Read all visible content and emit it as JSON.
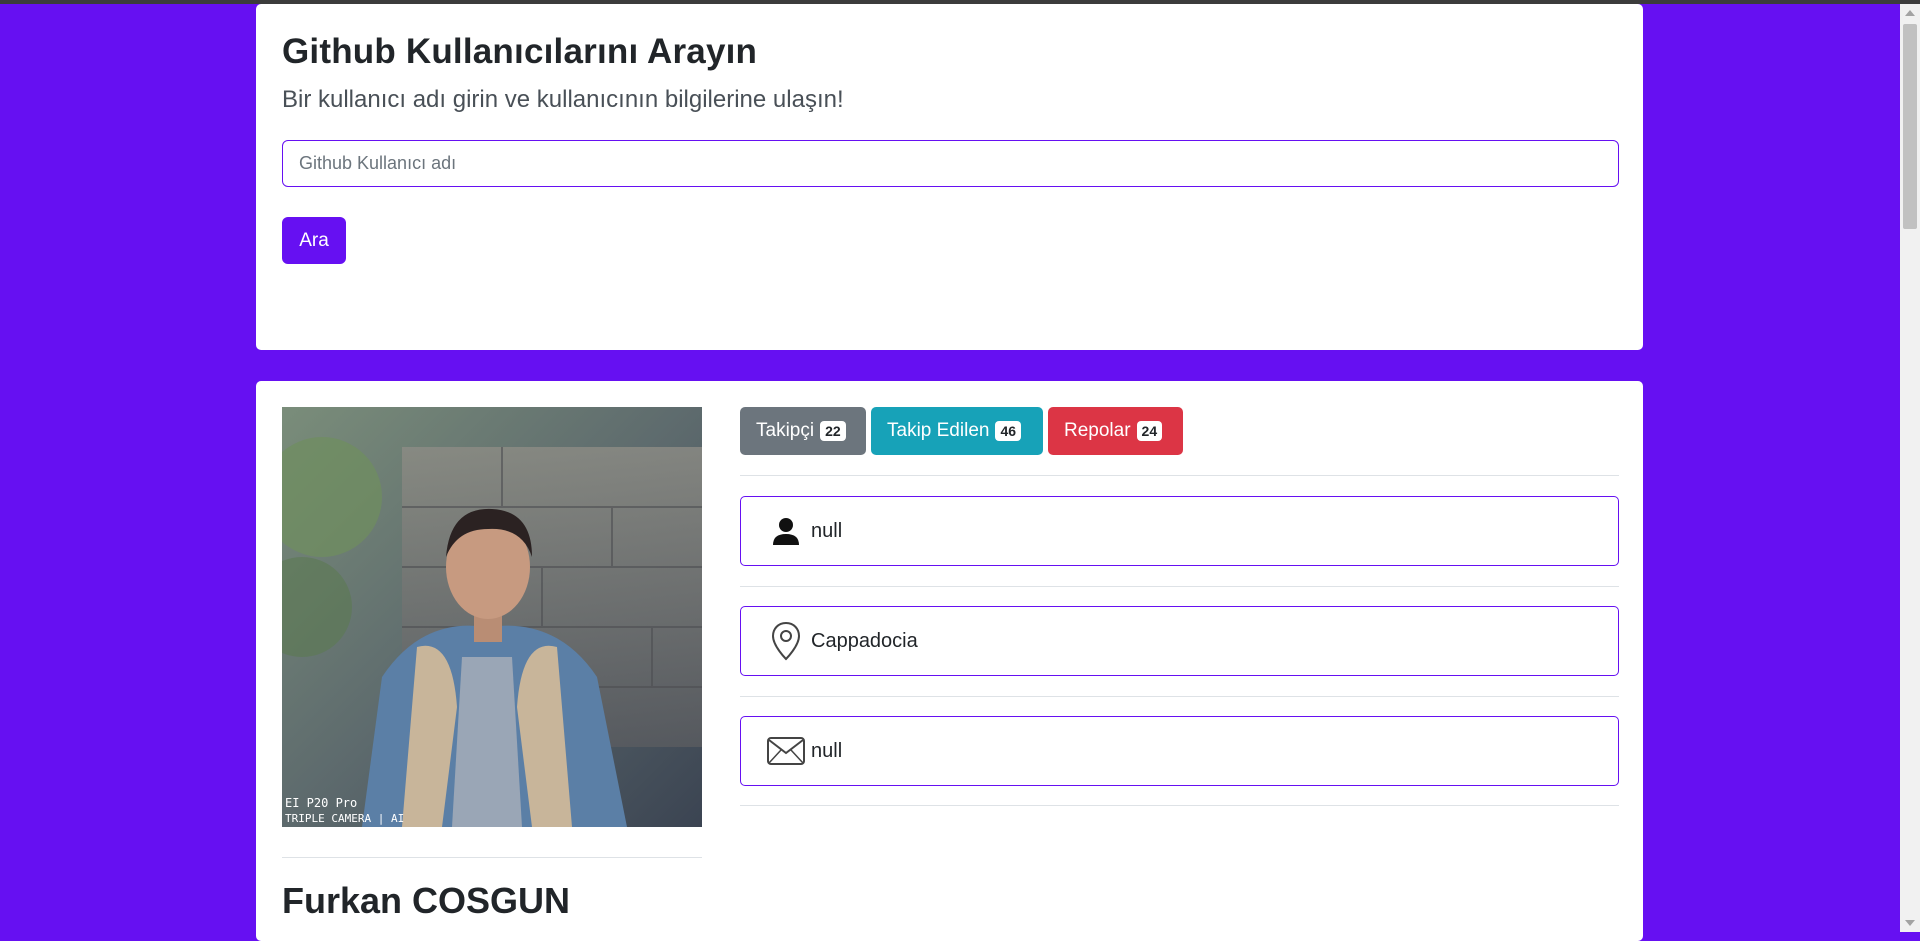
{
  "search": {
    "title": "Github Kullanıcılarını Arayın",
    "subtitle": "Bir kullanıcı adı girin ve kullanıcının bilgilerine ulaşın!",
    "placeholder": "Github Kullanıcı adı",
    "button_label": "Ara"
  },
  "profile": {
    "name": "Furkan COSGUN",
    "avatar_caption_line1": "EI P20 Pro",
    "avatar_caption_line2": "TRIPLE CAMERA | AI",
    "stats": {
      "followers_label": "Takipçi",
      "followers_count": "22",
      "following_label": "Takip Edilen",
      "following_count": "46",
      "repos_label": "Repolar",
      "repos_count": "24"
    },
    "info": {
      "company": "null",
      "location": "Cappadocia",
      "email": "null"
    },
    "icons": {
      "company": "person-icon",
      "location": "location-pin-icon",
      "email": "envelope-icon"
    }
  },
  "colors": {
    "background": "#6610f2",
    "followers": "#6c757d",
    "following": "#17a2b8",
    "repos": "#dc3545"
  }
}
